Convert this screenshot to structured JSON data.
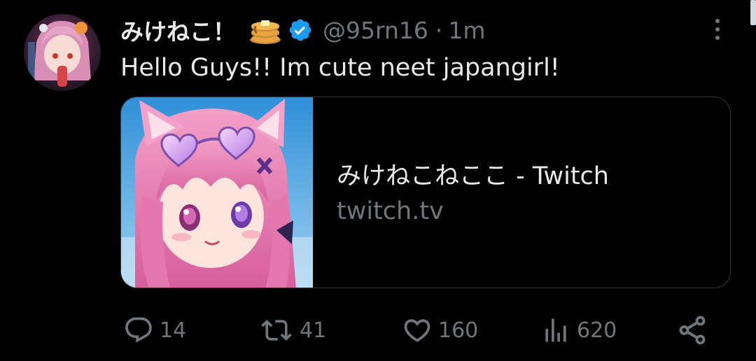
{
  "tweet": {
    "author": {
      "display_name": "みけねこ！",
      "emoji": "pancakes-emoji",
      "verified": true,
      "handle": "@95rn16",
      "separator": "·",
      "timestamp": "1m"
    },
    "text": "Hello Guys!! Im cute neet japangirl!",
    "card": {
      "title": "みけねこねここ - Twitch",
      "domain": "twitch.tv"
    },
    "actions": {
      "replies": "14",
      "retweets": "41",
      "likes": "160",
      "views": "620"
    }
  },
  "colors": {
    "background": "#000000",
    "primary_text": "#e7e9ea",
    "secondary_text": "#71767b",
    "verified_badge": "#1d9bf0",
    "card_border": "#333639"
  },
  "icons": [
    "more-icon",
    "verified-icon",
    "reply-icon",
    "retweet-icon",
    "like-icon",
    "views-icon",
    "share-icon"
  ]
}
